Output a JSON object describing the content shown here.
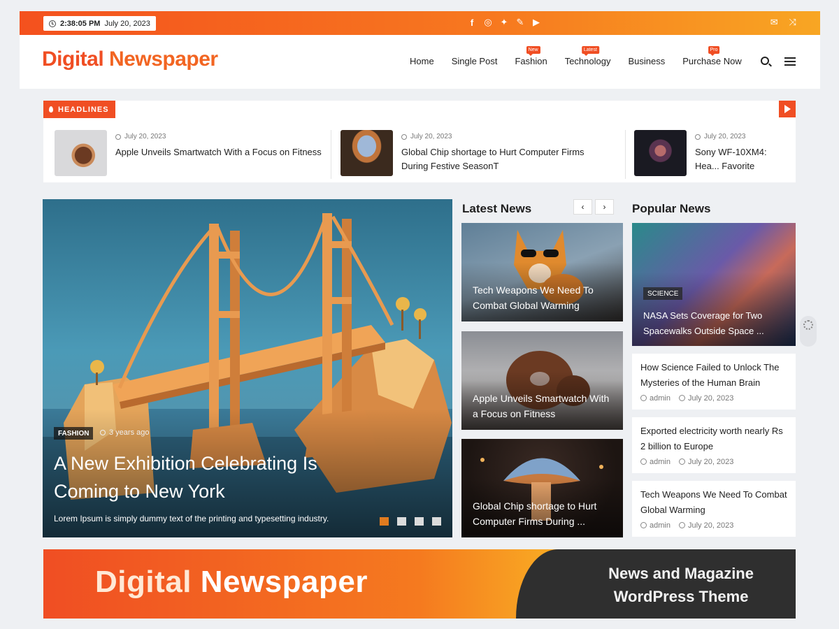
{
  "topbar": {
    "time": "2:38:05 PM",
    "date": "July 20, 2023",
    "socials": [
      "facebook-icon",
      "instagram-icon",
      "twitter-icon",
      "vk-icon",
      "youtube-icon"
    ],
    "right_icons": [
      "mail-icon",
      "shuffle-icon"
    ]
  },
  "header": {
    "logo_first": "Digital",
    "logo_second": "Newspaper",
    "nav": [
      {
        "label": "Home",
        "badge": ""
      },
      {
        "label": "Single Post",
        "badge": ""
      },
      {
        "label": "Fashion",
        "badge": "New"
      },
      {
        "label": "Technology",
        "badge": "Latest"
      },
      {
        "label": "Business",
        "badge": ""
      },
      {
        "label": "Purchase Now",
        "badge": "Pro"
      }
    ]
  },
  "headlines": {
    "label": "HEADLINES",
    "items": [
      {
        "date": "July 20, 2023",
        "title": "Apple Unveils Smartwatch With a Focus on Fitness"
      },
      {
        "date": "July 20, 2023",
        "title": "Global Chip shortage to Hurt Computer Firms During Festive SeasonT"
      },
      {
        "date": "July 20, 2023",
        "title": "Sony WF-10XM4: Hea... Favorite"
      }
    ]
  },
  "hero": {
    "category": "FASHION",
    "time": "3 years ago",
    "title": "A New Exhibition Celebrating Is Coming to New York",
    "desc": "Lorem Ipsum is simply dummy text of the printing and typesetting industry."
  },
  "latest": {
    "title": "Latest News",
    "cards": [
      {
        "title": "Tech Weapons We Need To Combat Global Warming"
      },
      {
        "title": "Apple Unveils Smartwatch With a Focus on Fitness"
      },
      {
        "title": "Global Chip shortage to Hurt Computer Firms During ..."
      }
    ]
  },
  "popular": {
    "title": "Popular News",
    "hero_tag": "SCIENCE",
    "hero_title": "NASA Sets Coverage for Two Spacewalks Outside Space ...",
    "items": [
      {
        "title": "How Science Failed to Unlock The Mysteries of the Human Brain",
        "author": "admin",
        "date": "July 20, 2023"
      },
      {
        "title": "Exported electricity worth nearly Rs 2 billion to Europe",
        "author": "admin",
        "date": "July 20, 2023"
      },
      {
        "title": "Tech Weapons We Need To Combat Global Warming",
        "author": "admin",
        "date": "July 20, 2023"
      }
    ]
  },
  "banner": {
    "logo_a": "Digital",
    "logo_b": "Newspaper",
    "line1": "News and Magazine",
    "line2": "WordPress Theme"
  }
}
